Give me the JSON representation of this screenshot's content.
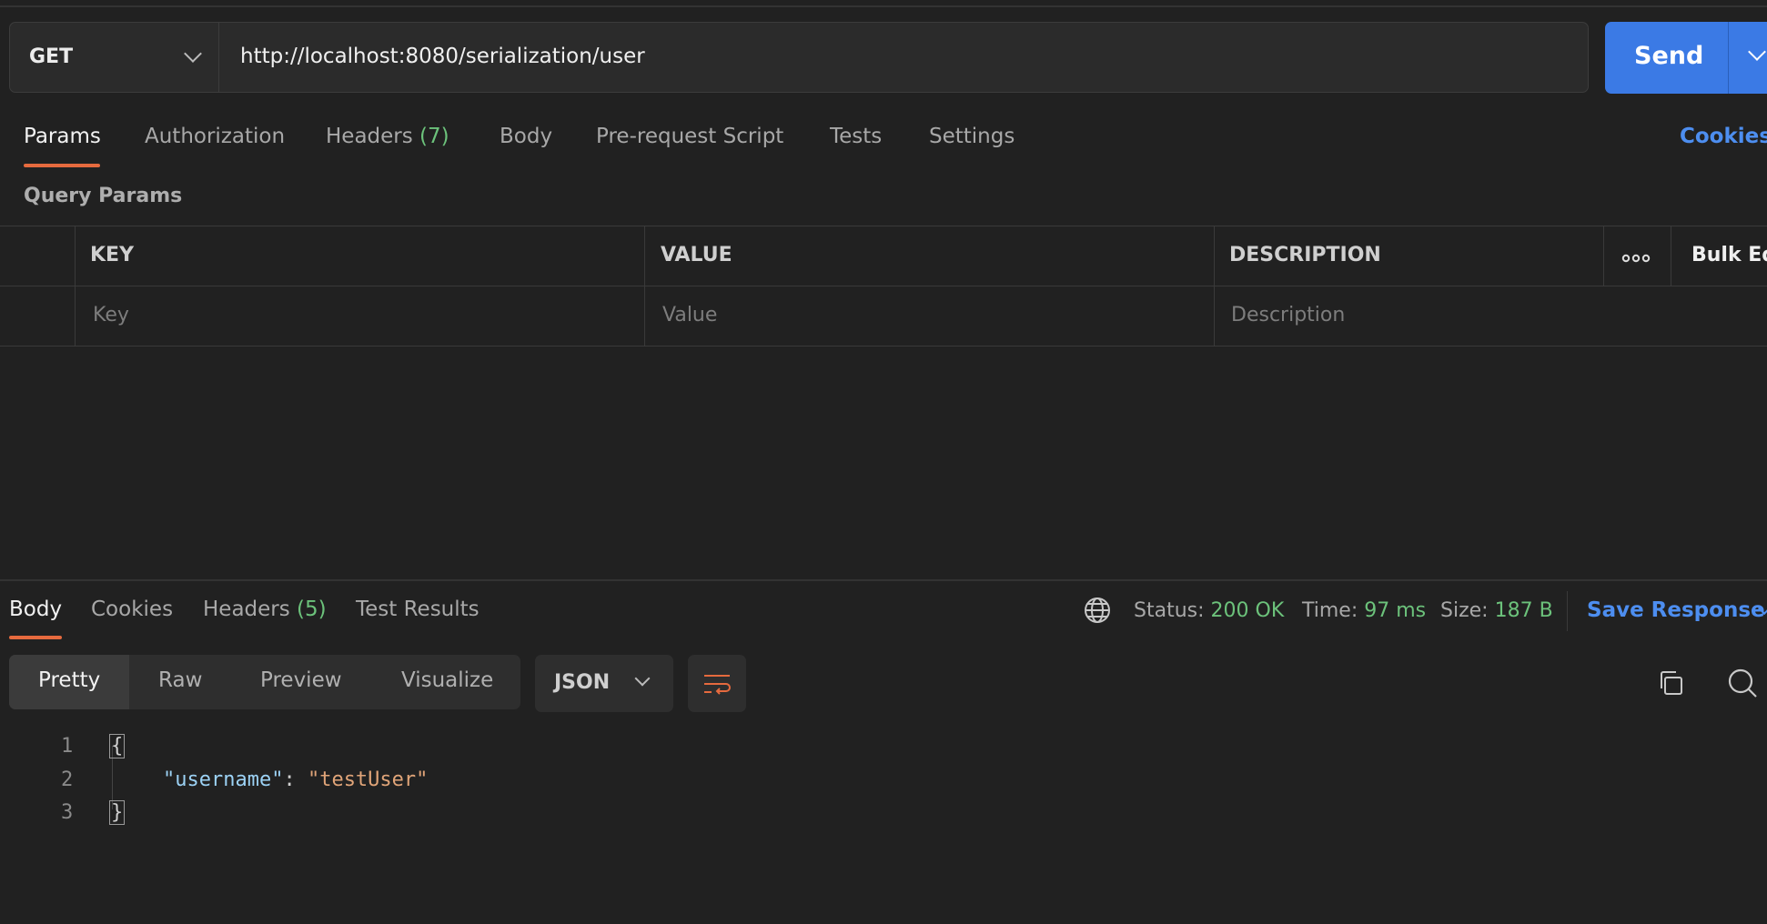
{
  "request": {
    "method": "GET",
    "url": "http://localhost:8080/serialization/user",
    "send_label": "Send"
  },
  "request_tabs": {
    "params": "Params",
    "authorization": "Authorization",
    "headers": "Headers",
    "headers_count": "(7)",
    "body": "Body",
    "prerequest": "Pre-request Script",
    "tests": "Tests",
    "settings": "Settings",
    "cookies": "Cookies"
  },
  "query_params": {
    "title": "Query Params",
    "columns": {
      "key": "KEY",
      "value": "VALUE",
      "description": "DESCRIPTION",
      "bulk_edit": "Bulk Ed"
    },
    "placeholders": {
      "key": "Key",
      "value": "Value",
      "description": "Description"
    }
  },
  "response_tabs": {
    "body": "Body",
    "cookies": "Cookies",
    "headers": "Headers",
    "headers_count": "(5)",
    "test_results": "Test Results"
  },
  "response_status": {
    "status_label": "Status:",
    "status_value": "200 OK",
    "time_label": "Time:",
    "time_value": "97 ms",
    "size_label": "Size:",
    "size_value": "187 B",
    "save_response": "Save Response"
  },
  "view_modes": {
    "pretty": "Pretty",
    "raw": "Raw",
    "preview": "Preview",
    "visualize": "Visualize",
    "format": "JSON"
  },
  "code": {
    "line_numbers": [
      "1",
      "2",
      "3"
    ],
    "open_brace": "{",
    "key": "\"username\"",
    "colon": ": ",
    "value": "\"testUser\"",
    "close_brace": "}"
  },
  "colors": {
    "accent": "#3b7ae5",
    "tab_underline": "#e66a3e",
    "success": "#6cc27b",
    "link": "#4d8ef0"
  }
}
